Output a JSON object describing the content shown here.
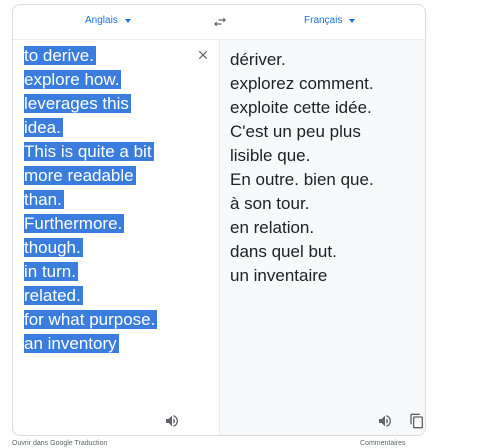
{
  "header": {
    "source_language": "Anglais",
    "target_language": "Français"
  },
  "source": {
    "lines": [
      "to derive.",
      "explore how.",
      "leverages this",
      "idea.",
      "This is quite a bit",
      "more readable",
      "than.",
      "Furthermore.",
      "though.",
      "in turn.",
      "related.",
      "for what purpose.",
      "an inventory"
    ]
  },
  "target": {
    "lines": [
      "dériver.",
      "explorez comment.",
      "exploite cette idée.",
      "C'est un peu plus",
      "lisible que.",
      "En outre. bien que.",
      "à son tour.",
      "en relation.",
      "dans quel but.",
      "un inventaire"
    ]
  },
  "footer": {
    "open_link": "Ouvrir dans Google Traduction",
    "feedback_link": "Commentaires"
  },
  "colors": {
    "accent": "#1a73e8",
    "selection": "#3b7ddd",
    "icon": "#5f6368"
  },
  "icons": [
    "swap-languages-icon",
    "clear-icon",
    "speaker-icon",
    "copy-icon",
    "chevron-down-icon"
  ]
}
